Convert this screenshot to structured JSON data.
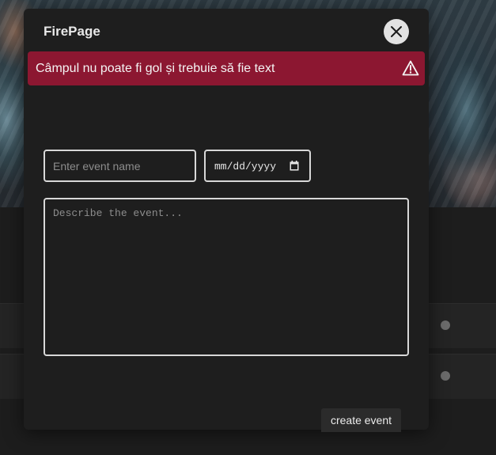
{
  "modal": {
    "title": "FirePage",
    "alert_message": "Câmpul nu poate fi gol și trebuie să fie text",
    "event_name_placeholder": "Enter event name",
    "date_placeholder": "mm/dd/yyyy",
    "description_placeholder": "Describe the event...",
    "create_label": "create event"
  },
  "icons": {
    "close": "close-icon",
    "alert": "warning-triangle-icon",
    "calendar": "calendar-icon"
  },
  "colors": {
    "alert_background": "#8c1731",
    "modal_background": "#1e1e1e",
    "field_border": "#d8d8d8"
  }
}
